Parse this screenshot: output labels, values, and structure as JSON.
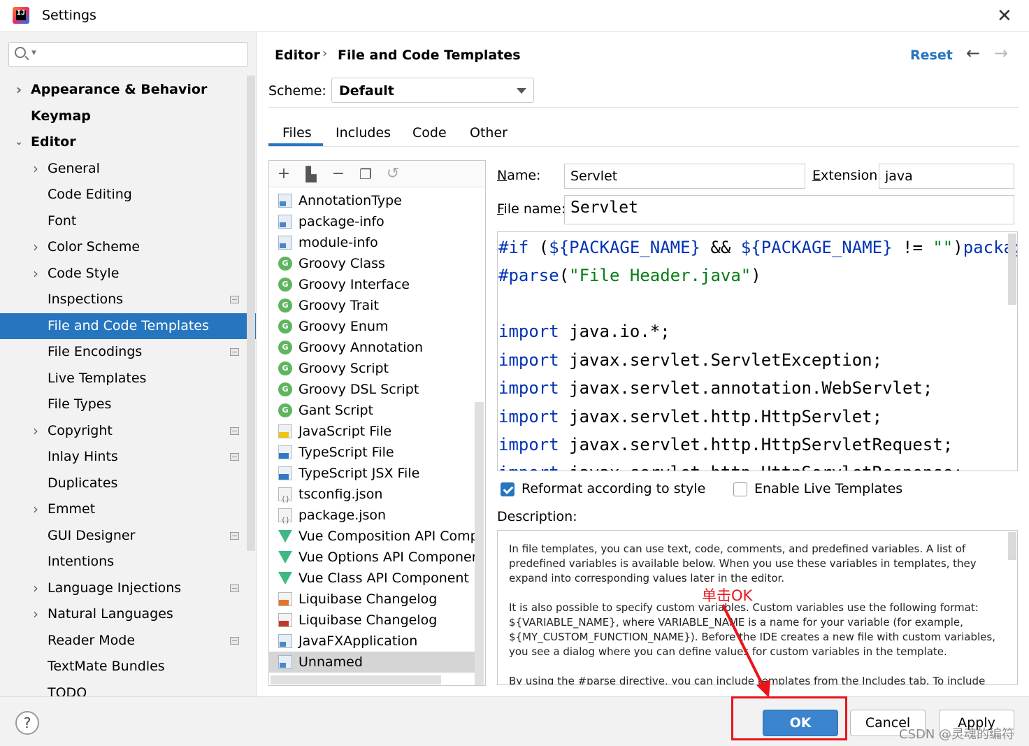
{
  "window": {
    "title": "Settings",
    "close_icon": "close-icon"
  },
  "sidebar": {
    "search_placeholder": "",
    "items": [
      {
        "label": "Appearance & Behavior",
        "bold": true,
        "expander": "collapsed",
        "indent": 0
      },
      {
        "label": "Keymap",
        "bold": true,
        "expander": "none",
        "indent": 0
      },
      {
        "label": "Editor",
        "bold": true,
        "expander": "expanded",
        "indent": 0
      },
      {
        "label": "General",
        "expander": "collapsed",
        "indent": 1
      },
      {
        "label": "Code Editing",
        "expander": "none",
        "indent": 1
      },
      {
        "label": "Font",
        "expander": "none",
        "indent": 1
      },
      {
        "label": "Color Scheme",
        "expander": "collapsed",
        "indent": 1
      },
      {
        "label": "Code Style",
        "expander": "collapsed",
        "indent": 1
      },
      {
        "label": "Inspections",
        "expander": "none",
        "indent": 1,
        "project_icon": true
      },
      {
        "label": "File and Code Templates",
        "expander": "none",
        "indent": 1,
        "selected": true
      },
      {
        "label": "File Encodings",
        "expander": "none",
        "indent": 1,
        "project_icon": true
      },
      {
        "label": "Live Templates",
        "expander": "none",
        "indent": 1
      },
      {
        "label": "File Types",
        "expander": "none",
        "indent": 1
      },
      {
        "label": "Copyright",
        "expander": "collapsed",
        "indent": 1,
        "project_icon": true
      },
      {
        "label": "Inlay Hints",
        "expander": "none",
        "indent": 1,
        "project_icon": true
      },
      {
        "label": "Duplicates",
        "expander": "none",
        "indent": 1
      },
      {
        "label": "Emmet",
        "expander": "collapsed",
        "indent": 1
      },
      {
        "label": "GUI Designer",
        "expander": "none",
        "indent": 1,
        "project_icon": true
      },
      {
        "label": "Intentions",
        "expander": "none",
        "indent": 1
      },
      {
        "label": "Language Injections",
        "expander": "collapsed",
        "indent": 1,
        "project_icon": true
      },
      {
        "label": "Natural Languages",
        "expander": "collapsed",
        "indent": 1
      },
      {
        "label": "Reader Mode",
        "expander": "none",
        "indent": 1,
        "project_icon": true
      },
      {
        "label": "TextMate Bundles",
        "expander": "none",
        "indent": 1
      },
      {
        "label": "TODO",
        "expander": "none",
        "indent": 1
      }
    ]
  },
  "header": {
    "breadcrumb": [
      "Editor",
      "File and Code Templates"
    ],
    "reset_label": "Reset",
    "back_icon": "arrow-left-icon",
    "forward_icon": "arrow-right-icon"
  },
  "scheme": {
    "label": "Scheme:",
    "value": "Default"
  },
  "tabs": [
    {
      "label": "Files",
      "active": true
    },
    {
      "label": "Includes"
    },
    {
      "label": "Code"
    },
    {
      "label": "Other"
    }
  ],
  "toolbar_icons": [
    "add-icon",
    "copy-template-icon",
    "remove-icon",
    "duplicate-icon",
    "revert-icon"
  ],
  "templates": [
    {
      "label": "AnnotationType",
      "icon": "java"
    },
    {
      "label": "package-info",
      "icon": "java"
    },
    {
      "label": "module-info",
      "icon": "java"
    },
    {
      "label": "Groovy Class",
      "icon": "groovy"
    },
    {
      "label": "Groovy Interface",
      "icon": "groovy"
    },
    {
      "label": "Groovy Trait",
      "icon": "groovy"
    },
    {
      "label": "Groovy Enum",
      "icon": "groovy"
    },
    {
      "label": "Groovy Annotation",
      "icon": "groovy"
    },
    {
      "label": "Groovy Script",
      "icon": "groovy"
    },
    {
      "label": "Groovy DSL Script",
      "icon": "groovy"
    },
    {
      "label": "Gant Script",
      "icon": "groovy"
    },
    {
      "label": "JavaScript File",
      "icon": "js"
    },
    {
      "label": "TypeScript File",
      "icon": "ts"
    },
    {
      "label": "TypeScript JSX File",
      "icon": "ts"
    },
    {
      "label": "tsconfig.json",
      "icon": "json"
    },
    {
      "label": "package.json",
      "icon": "json"
    },
    {
      "label": "Vue Composition API Component",
      "icon": "vue"
    },
    {
      "label": "Vue Options API Component",
      "icon": "vue"
    },
    {
      "label": "Vue Class API Component",
      "icon": "vue"
    },
    {
      "label": "Liquibase Changelog",
      "icon": "xml"
    },
    {
      "label": "Liquibase Changelog",
      "icon": "yml"
    },
    {
      "label": "JavaFXApplication",
      "icon": "java"
    },
    {
      "label": "Unnamed",
      "icon": "java",
      "selected": true
    }
  ],
  "form": {
    "name_label": "Name:",
    "name_value": "Servlet",
    "extension_label": "Extension:",
    "extension_value": "java",
    "filename_label": "File name:",
    "filename_value": "Servlet"
  },
  "code_lines": [
    [
      {
        "t": "#if",
        "c": "kw"
      },
      {
        "t": " (",
        "c": "plain"
      },
      {
        "t": "${PACKAGE_NAME}",
        "c": "var"
      },
      {
        "t": " && ",
        "c": "plain"
      },
      {
        "t": "${PACKAGE_NAME}",
        "c": "var"
      },
      {
        "t": " != ",
        "c": "plain"
      },
      {
        "t": "\"\"",
        "c": "str"
      },
      {
        "t": ")",
        "c": "plain"
      },
      {
        "t": "package",
        "c": "kw"
      }
    ],
    [
      {
        "t": "#parse",
        "c": "kw"
      },
      {
        "t": "(",
        "c": "plain"
      },
      {
        "t": "\"File Header.java\"",
        "c": "str"
      },
      {
        "t": ")",
        "c": "plain"
      }
    ],
    [],
    [
      {
        "t": "import",
        "c": "kw"
      },
      {
        "t": " java.io.*;",
        "c": "plain"
      }
    ],
    [
      {
        "t": "import",
        "c": "kw"
      },
      {
        "t": " javax.servlet.ServletException;",
        "c": "plain"
      }
    ],
    [
      {
        "t": "import",
        "c": "kw"
      },
      {
        "t": " javax.servlet.annotation.WebServlet;",
        "c": "plain"
      }
    ],
    [
      {
        "t": "import",
        "c": "kw"
      },
      {
        "t": " javax.servlet.http.HttpServlet;",
        "c": "plain"
      }
    ],
    [
      {
        "t": "import",
        "c": "kw"
      },
      {
        "t": " javax.servlet.http.HttpServletRequest;",
        "c": "plain"
      }
    ],
    [
      {
        "t": "import",
        "c": "kw"
      },
      {
        "t": " javax.servlet.http.HttpServletResponse;",
        "c": "plain"
      }
    ]
  ],
  "options": {
    "reformat_label": "Reformat according to style",
    "reformat_checked": true,
    "live_templates_label": "Enable Live Templates",
    "live_templates_checked": false
  },
  "description": {
    "label": "Description:",
    "paragraphs": [
      "In file templates, you can use text, code, comments, and predefined variables. A list of predefined variables is available below. When you use these variables in templates, they expand into corresponding values later in the editor.",
      "It is also possible to specify custom variables. Custom variables use the following format: ${VARIABLE_NAME}, where VARIABLE_NAME is a name for your variable (for example, ${MY_CUSTOM_FUNCTION_NAME}). Before the IDE creates a new file with custom variables, you see a dialog where you can define values for custom variables in the template.",
      "By using the #parse directive, you can include templates from the Includes tab. To include"
    ]
  },
  "annotation": {
    "text": "单击OK",
    "color": "#e8151b"
  },
  "buttons": {
    "ok": "OK",
    "cancel": "Cancel",
    "apply": "Apply",
    "help": "?"
  },
  "watermark": "CSDN @灵魂的编符",
  "colors": {
    "accent": "#2675bf",
    "selected_row": "#2675bf",
    "ok_button": "#3d84ce",
    "annotation": "#e8151b"
  }
}
